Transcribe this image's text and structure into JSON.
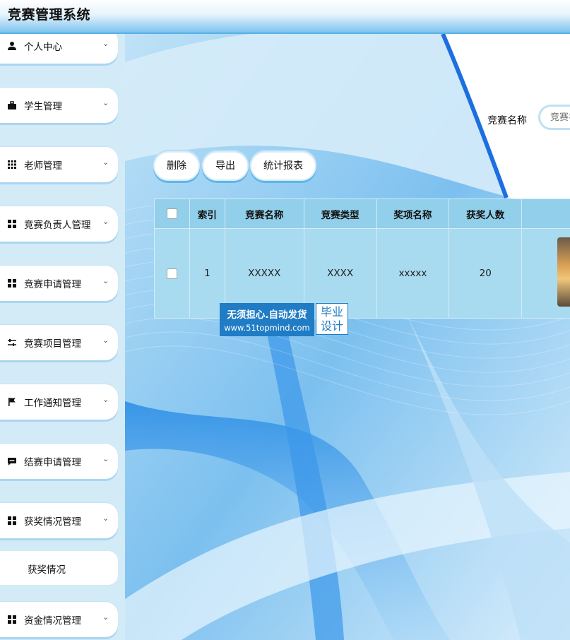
{
  "app": {
    "title": "竞赛管理系统"
  },
  "sidebar": {
    "items": [
      {
        "label": "个人中心",
        "icon": "user-icon"
      },
      {
        "label": "学生管理",
        "icon": "briefcase-icon"
      },
      {
        "label": "老师管理",
        "icon": "grid-icon"
      },
      {
        "label": "竞赛负责人管理",
        "icon": "apps-icon"
      },
      {
        "label": "竞赛申请管理",
        "icon": "apps-icon"
      },
      {
        "label": "竞赛项目管理",
        "icon": "sliders-icon"
      },
      {
        "label": "工作通知管理",
        "icon": "flag-icon"
      },
      {
        "label": "结赛申请管理",
        "icon": "comment-icon"
      },
      {
        "label": "获奖情况管理",
        "icon": "apps-icon"
      },
      {
        "label": "资金情况管理",
        "icon": "apps-icon"
      }
    ],
    "sub_item": {
      "label": "获奖情况"
    }
  },
  "search": {
    "label": "竞赛名称",
    "placeholder": "竞赛名称"
  },
  "toolbar": {
    "delete_label": "删除",
    "export_label": "导出",
    "report_label": "统计报表"
  },
  "table": {
    "headers": [
      "索引",
      "竞赛名称",
      "竞赛类型",
      "奖项名称",
      "获奖人数"
    ],
    "rows": [
      {
        "index": "1",
        "name": "XXXXX",
        "type": "XXXX",
        "award": "xxxxx",
        "count": "20"
      }
    ]
  },
  "watermark": {
    "line1": "无须担心.自动发货",
    "line2": "www.51topmind.com",
    "badge": "毕业设计"
  }
}
